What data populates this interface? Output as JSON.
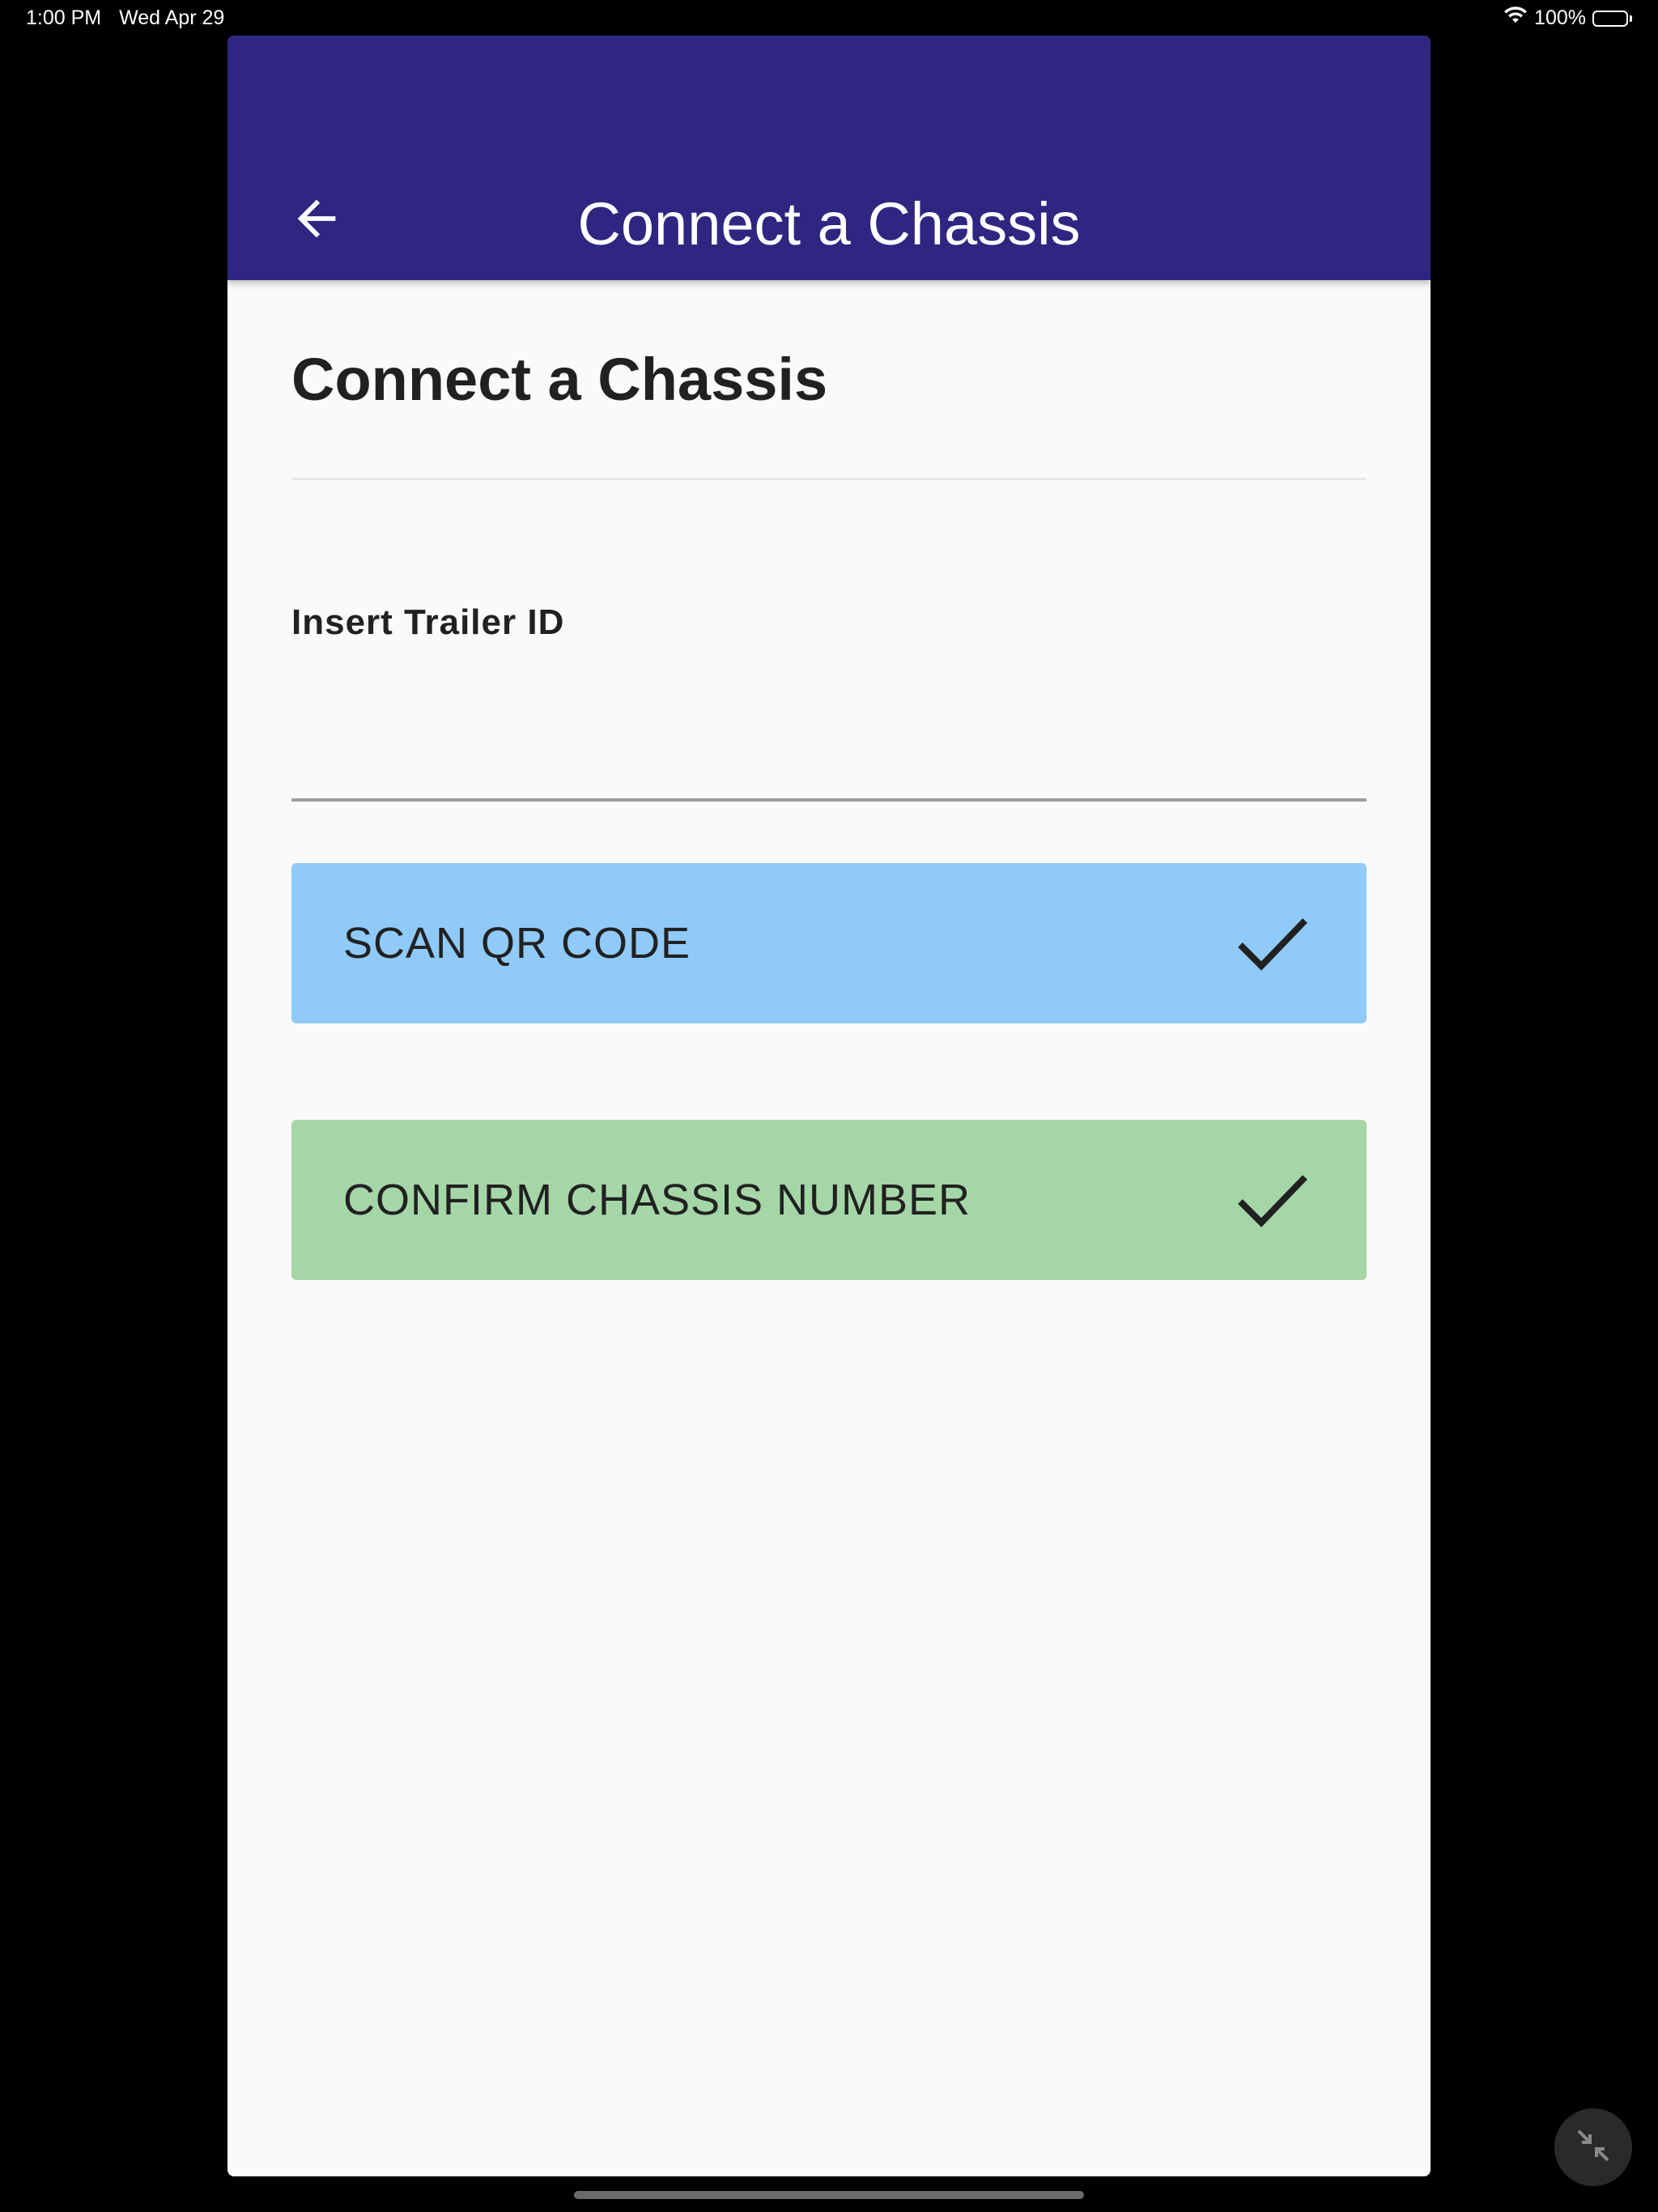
{
  "status_bar": {
    "time": "1:00 PM",
    "date": "Wed Apr 29",
    "battery": "100%"
  },
  "app_bar": {
    "title": "Connect a Chassis",
    "back_icon": "arrow-back-icon",
    "background_color": "#2e2680"
  },
  "page": {
    "title": "Connect a Chassis"
  },
  "trailer_field": {
    "label": "Insert Trailer ID",
    "value": "",
    "placeholder": ""
  },
  "buttons": {
    "scan": {
      "label": "SCAN QR CODE",
      "icon": "check-icon",
      "color": "#90caf9"
    },
    "confirm": {
      "label": "CONFIRM CHASSIS NUMBER",
      "icon": "check-icon",
      "color": "#a5d6a7"
    }
  },
  "system": {
    "minimize_icon": "minimize-arrows-icon"
  }
}
